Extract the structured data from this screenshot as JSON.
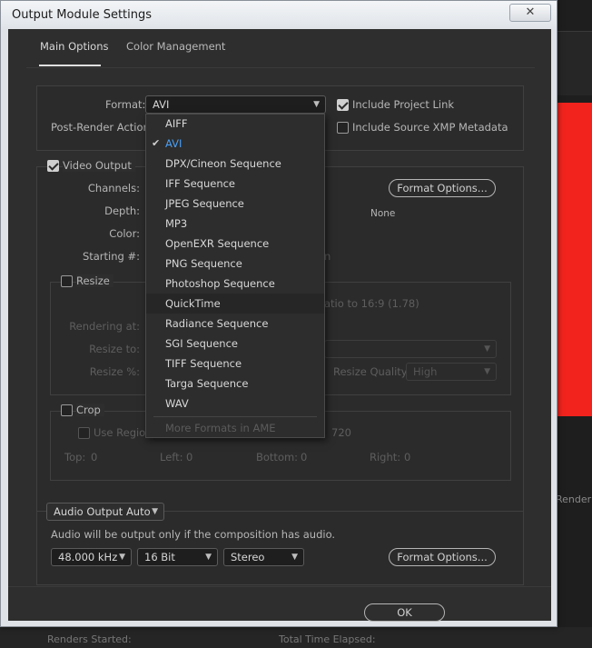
{
  "window": {
    "title": "Output Module Settings",
    "close_label": "✕"
  },
  "tabs": [
    {
      "label": "Main Options",
      "active": true
    },
    {
      "label": "Color Management",
      "active": false
    }
  ],
  "format": {
    "label": "Format:",
    "value": "AVI"
  },
  "post_render": {
    "label": "Post-Render Action:"
  },
  "include_project_link": {
    "label": "Include Project Link",
    "checked": true
  },
  "include_xmp": {
    "label": "Include Source XMP Metadata",
    "checked": false
  },
  "video_output": {
    "label": "Video Output",
    "checked": true,
    "channels_label": "Channels:",
    "depth_label": "Depth:",
    "color_label": "Color:",
    "starting_label": "Starting #:",
    "format_options_label": "Format Options...",
    "codec_value": "None"
  },
  "resize": {
    "label": "Resize",
    "checked": false,
    "rendering_at_label": "Rendering at:",
    "resize_to_label": "Resize to:",
    "resize_pct_label": "Resize %:",
    "aspect_text": "atio to 16:9 (1.78)",
    "quality_label": "Resize Quality:",
    "quality_value": "High"
  },
  "crop": {
    "label": "Crop",
    "checked": false,
    "use_region_label": "Use Region",
    "region_size": "720",
    "top_label": "Top:",
    "top_value": "0",
    "left_label": "Left:",
    "left_value": "0",
    "bottom_label": "Bottom:",
    "bottom_value": "0",
    "right_label": "Right:",
    "right_value": "0"
  },
  "audio": {
    "mode_value": "Audio Output Auto",
    "note": "Audio will be output only if the composition has audio.",
    "rate_value": "48.000 kHz",
    "bits_value": "16 Bit",
    "channels_value": "Stereo",
    "format_options_label": "Format Options..."
  },
  "ok_label": "OK",
  "format_menu": {
    "items": [
      "AIFF",
      "AVI",
      "DPX/Cineon Sequence",
      "IFF Sequence",
      "JPEG Sequence",
      "MP3",
      "OpenEXR Sequence",
      "PNG Sequence",
      "Photoshop Sequence",
      "QuickTime",
      "Radiance Sequence",
      "SGI Sequence",
      "TIFF Sequence",
      "Targa Sequence",
      "WAV"
    ],
    "selected": "AVI",
    "hovered": "QuickTime",
    "more": "More Formats in AME"
  },
  "background": {
    "render_label": "Render",
    "renders_started": "Renders Started:",
    "total_time": "Total Time Elapsed:"
  },
  "colors": {
    "accent": "#4a9ff5",
    "bg_red": "#f2231d",
    "panel": "#2e2e2e"
  }
}
